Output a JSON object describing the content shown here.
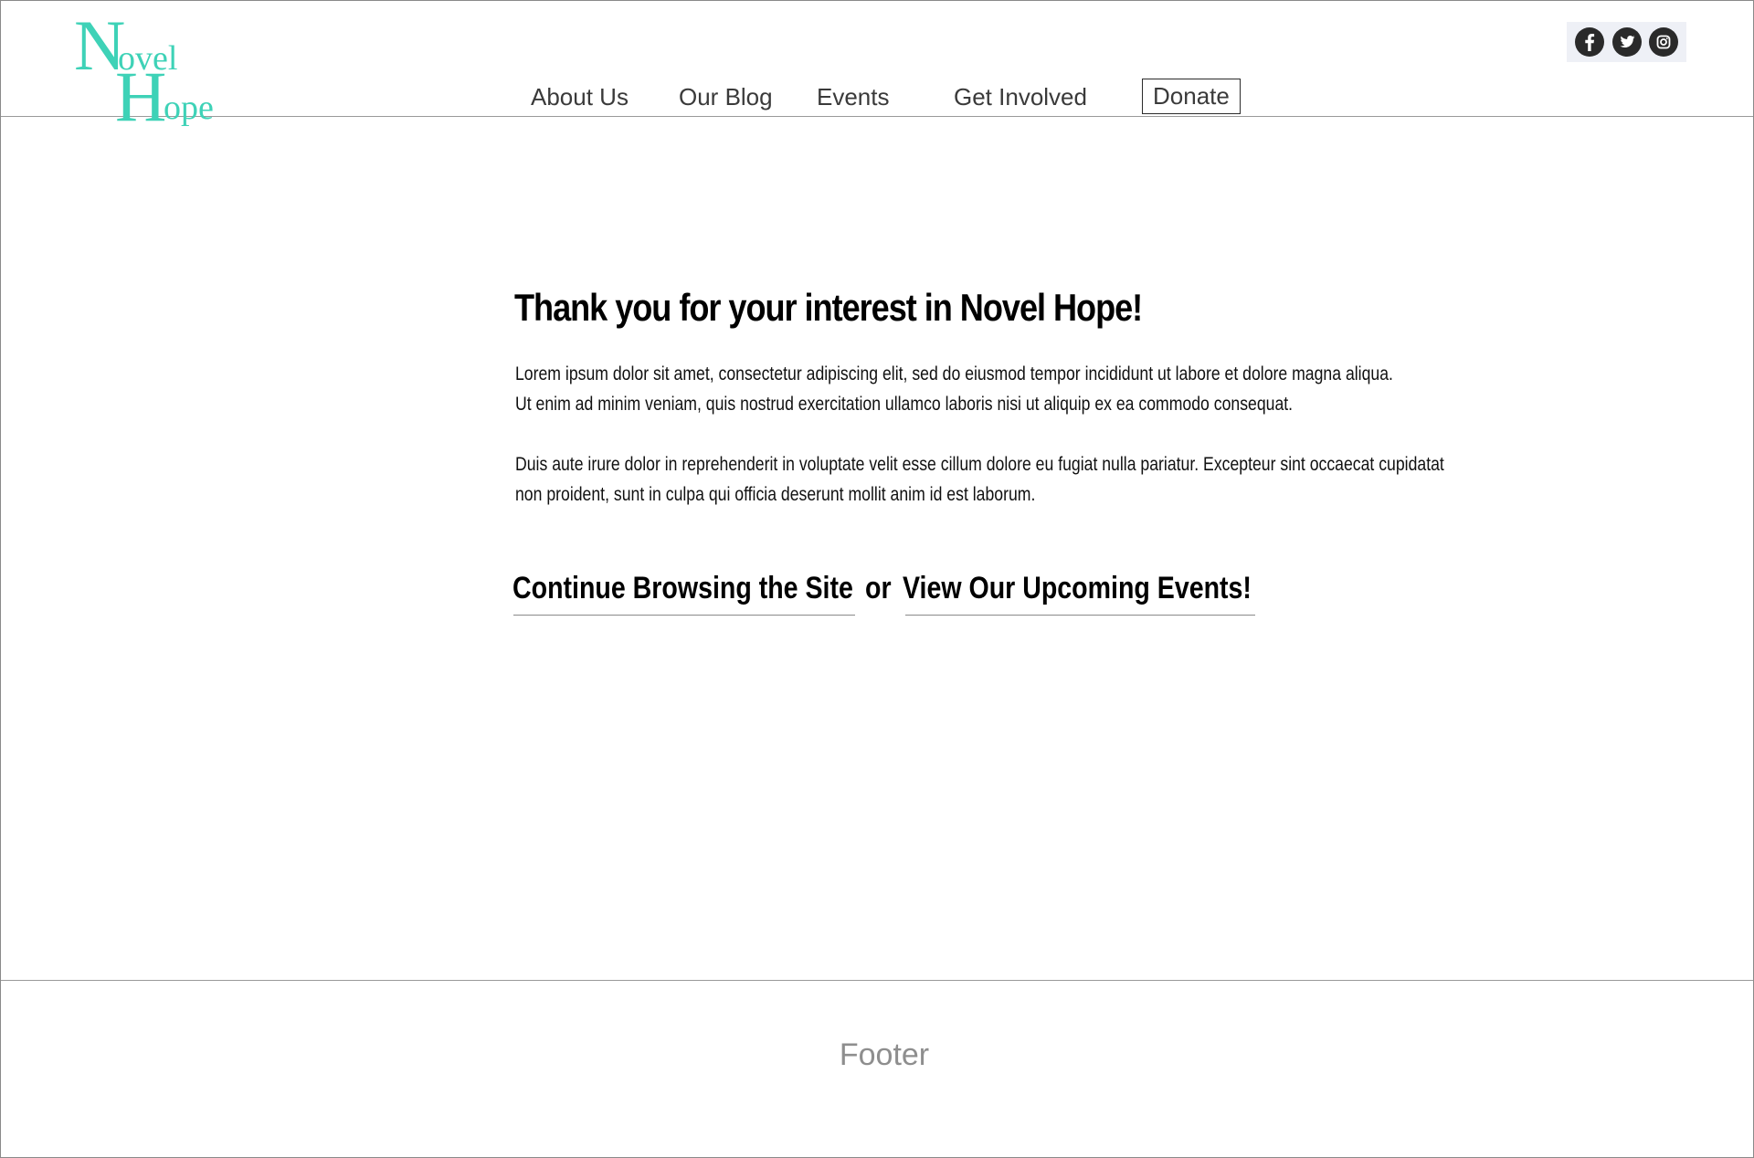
{
  "header": {
    "logo": {
      "line1_initial": "N",
      "line1_rest": "ovel",
      "line2_initial": "H",
      "line2_rest": "ope",
      "color": "#3ed2b7"
    },
    "nav": {
      "about": "About Us",
      "blog": "Our Blog",
      "events": "Events",
      "involved": "Get Involved",
      "donate": "Donate"
    },
    "social": {
      "icons": [
        "facebook-icon",
        "twitter-icon",
        "instagram-icon"
      ],
      "background": "#eef0f6"
    }
  },
  "main": {
    "heading": "Thank you for your interest in Novel Hope!",
    "paragraph1": [
      "Lorem ipsum dolor sit amet, consectetur adipiscing elit, sed do eiusmod tempor incididunt ut labore et dolore magna aliqua.",
      "Ut enim ad minim veniam, quis nostrud exercitation ullamco laboris nisi ut aliquip ex ea commodo consequat."
    ],
    "paragraph2": [
      "Duis aute irure dolor in reprehenderit in voluptate velit esse cillum dolore eu fugiat nulla pariatur. Excepteur sint occaecat cupidatat",
      "non proident, sunt in culpa qui officia deserunt mollit anim id est laborum."
    ],
    "cta": {
      "browse": "Continue Browsing the Site",
      "or": "or",
      "events": "View Our Upcoming Events!"
    }
  },
  "footer": {
    "label": "Footer"
  }
}
